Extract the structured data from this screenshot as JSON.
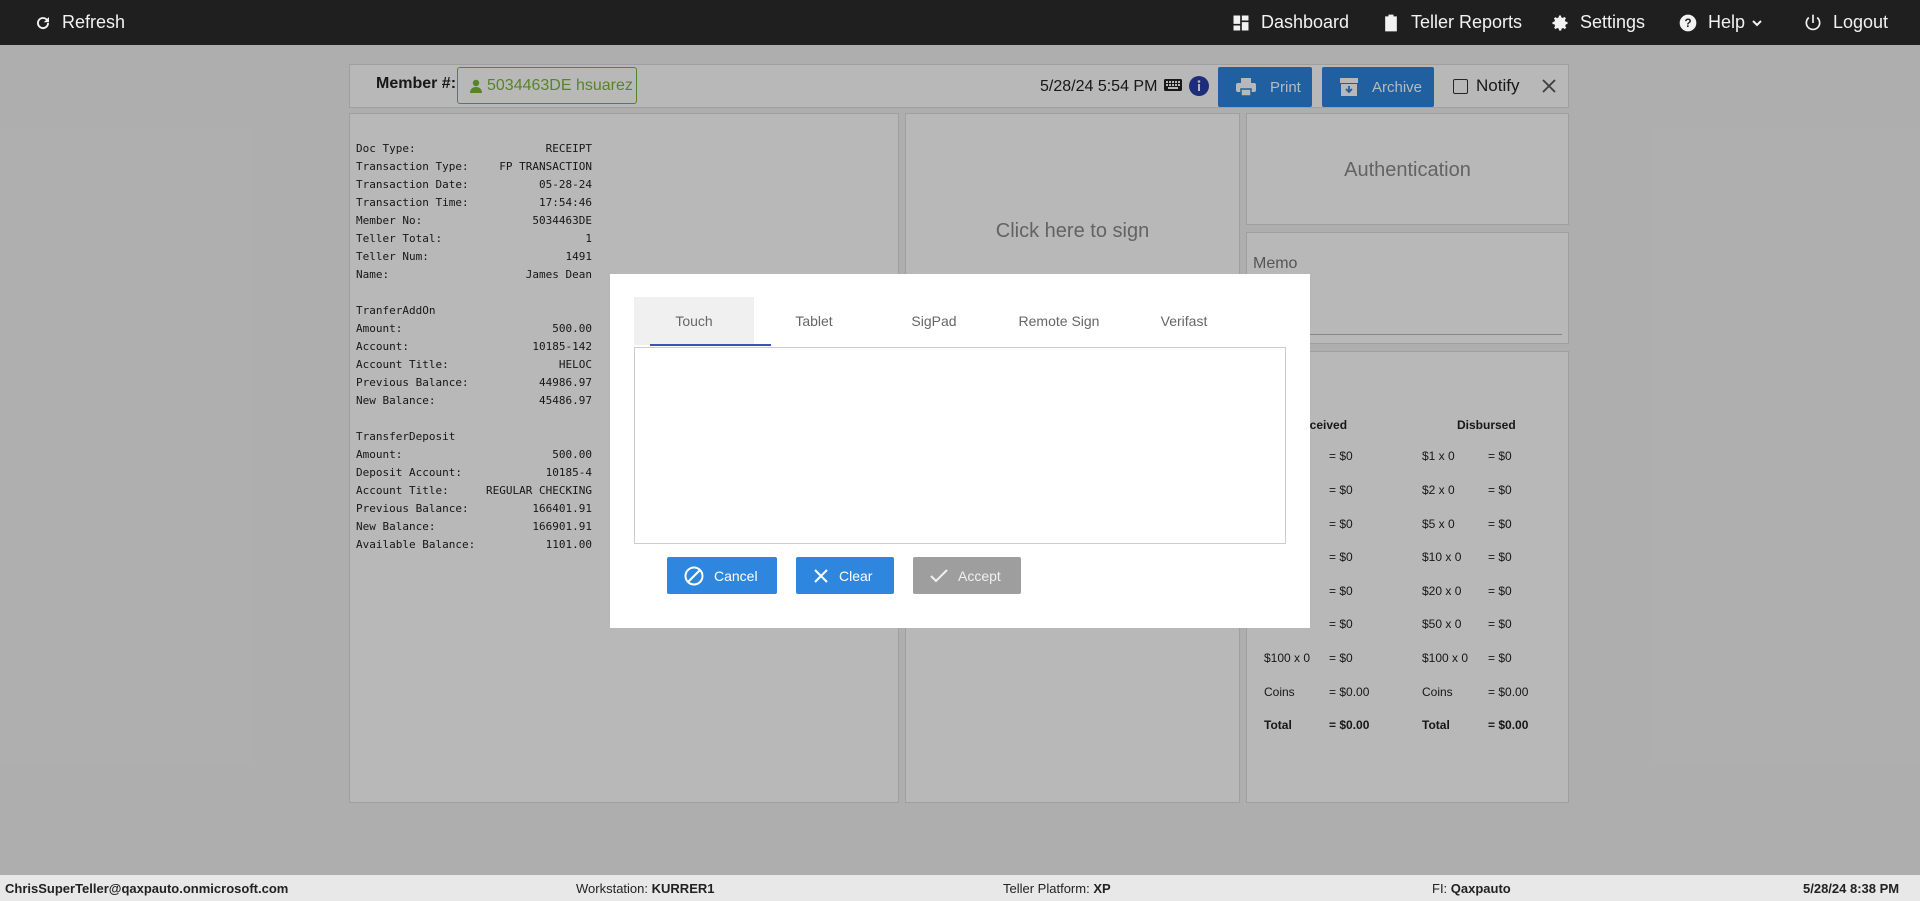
{
  "topbar": {
    "refresh_label": "Refresh",
    "nav": [
      {
        "label": "Dashboard"
      },
      {
        "label": "Teller Reports"
      },
      {
        "label": "Settings"
      },
      {
        "label": "Help"
      },
      {
        "label": "Logout"
      }
    ]
  },
  "member": {
    "label": "Member #:",
    "value": "5034463DE hsuarez",
    "datetime": "5/28/24 5:54 PM"
  },
  "actions": {
    "print_label": "Print",
    "archive_label": "Archive",
    "notify_label": "Notify"
  },
  "receipt": {
    "rows": [
      {
        "k": "Doc Type:",
        "v": "RECEIPT"
      },
      {
        "k": "Transaction Type:",
        "v": "FP TRANSACTION"
      },
      {
        "k": "Transaction Date:",
        "v": "05-28-24"
      },
      {
        "k": "Transaction Time:",
        "v": "17:54:46"
      },
      {
        "k": "Member No:",
        "v": "5034463DE"
      },
      {
        "k": "Teller Total:",
        "v": "1"
      },
      {
        "k": "Teller Num:",
        "v": "1491"
      },
      {
        "k": "Name:",
        "v": "James Dean"
      }
    ],
    "section1_title": "TranferAddOn",
    "section1": [
      {
        "k": "Amount:",
        "v": "500.00"
      },
      {
        "k": "Account:",
        "v": "10185-142"
      },
      {
        "k": "Account Title:",
        "v": "HELOC"
      },
      {
        "k": "Previous Balance:",
        "v": "44986.97"
      },
      {
        "k": "New Balance:",
        "v": "45486.97"
      }
    ],
    "section2_title": "TransferDeposit",
    "section2": [
      {
        "k": "Amount:",
        "v": "500.00"
      },
      {
        "k": "Deposit Account:",
        "v": "10185-4"
      },
      {
        "k": "Account Title:",
        "v": "REGULAR CHECKING"
      },
      {
        "k": "Previous Balance:",
        "v": "166401.91"
      },
      {
        "k": "New Balance:",
        "v": "166901.91"
      },
      {
        "k": "Available Balance:",
        "v": "1101.00"
      }
    ]
  },
  "signature_panel": {
    "text": "Click here to sign"
  },
  "auth_panel": {
    "text": "Authentication"
  },
  "memo": {
    "label": "Memo"
  },
  "cash": {
    "received_header": "eceived",
    "disbursed_header": "Disbursed",
    "received": [
      {
        "d": "",
        "v": "= $0"
      },
      {
        "d": "",
        "v": "= $0"
      },
      {
        "d": "",
        "v": "= $0"
      },
      {
        "d": "",
        "v": "= $0"
      },
      {
        "d": "",
        "v": "= $0"
      },
      {
        "d": "",
        "v": "= $0"
      },
      {
        "d": "$100 x 0",
        "v": "= $0"
      },
      {
        "d": "Coins",
        "v": "= $0.00"
      }
    ],
    "disbursed": [
      {
        "d": "$1 x 0",
        "v": "= $0"
      },
      {
        "d": "$2 x 0",
        "v": "= $0"
      },
      {
        "d": "$5 x 0",
        "v": "= $0"
      },
      {
        "d": "$10 x 0",
        "v": "= $0"
      },
      {
        "d": "$20 x 0",
        "v": "= $0"
      },
      {
        "d": "$50 x 0",
        "v": "= $0"
      },
      {
        "d": "$100 x 0",
        "v": "= $0"
      },
      {
        "d": "Coins",
        "v": "= $0.00"
      }
    ],
    "total_label": "Total",
    "received_total": "= $0.00",
    "disbursed_total": "= $0.00"
  },
  "modal": {
    "tabs": [
      "Touch",
      "Tablet",
      "SigPad",
      "Remote Sign",
      "Verifast"
    ],
    "cancel_label": "Cancel",
    "clear_label": "Clear",
    "accept_label": "Accept"
  },
  "footer": {
    "user": "ChrisSuperTeller@qaxpauto.onmicrosoft.com",
    "workstation_label": "Workstation:",
    "workstation": "KURRER1",
    "platform_label": "Teller Platform:",
    "platform": "XP",
    "fi_label": "FI:",
    "fi": "Qaxpauto",
    "datetime": "5/28/24 8:38 PM"
  },
  "colors": {
    "topbar": "#1f1f1f",
    "accent": "#2f86de",
    "member_green": "#7ab83a",
    "tab_underline": "#3f51b5",
    "disabled": "#9e9e9e"
  }
}
